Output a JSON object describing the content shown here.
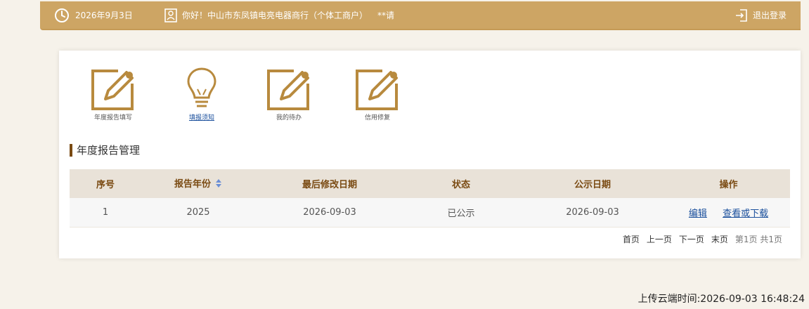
{
  "header": {
    "date": "2026年9月3日",
    "greeting": "你好！中山市东凤镇电亮电器商行（个体工商户）",
    "password_hint": "**请",
    "logout_label": "退出登录"
  },
  "tiles": [
    {
      "label": "年度报告填写",
      "icon": "edit-icon"
    },
    {
      "label": "填报须知",
      "icon": "lightbulb-icon"
    },
    {
      "label": "我的待办",
      "icon": "edit-icon"
    },
    {
      "label": "信用修复",
      "icon": "edit-icon"
    }
  ],
  "section_title": "年度报告管理",
  "table": {
    "headers": [
      "序号",
      "报告年份",
      "最后修改日期",
      "状态",
      "公示日期",
      "操作"
    ],
    "rows": [
      {
        "index": "1",
        "year": "2025",
        "modified": "2026-09-03",
        "status": "已公示",
        "public_date": "2026-09-03",
        "edit": "编辑",
        "view": "查看或下载"
      }
    ]
  },
  "pager": {
    "first": "首页",
    "prev": "上一页",
    "next": "下一页",
    "last": "末页",
    "info": "第1页 共1页"
  },
  "footer": {
    "upload_time": "上传云端时间:2026-09-03 16:48:24"
  },
  "colors": {
    "header_bg": "#cda564",
    "accent_brown": "#7a4a12",
    "icon_gold": "#b88a3e",
    "link_blue": "#1a4f9c"
  }
}
